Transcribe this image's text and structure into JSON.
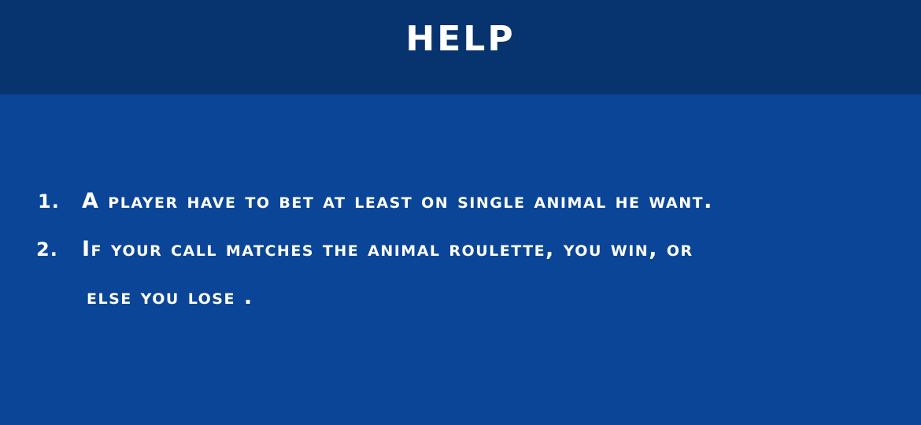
{
  "header": {
    "title": "HELP"
  },
  "rules": [
    {
      "number": "1.",
      "lines": [
        "A player have to bet at least on single animal he want."
      ]
    },
    {
      "number": "2.",
      "lines": [
        "If your call matches the animal roulette, you win, or",
        "else you lose ."
      ]
    }
  ],
  "colors": {
    "header_bg": "#07336f",
    "body_bg": "#0a4597",
    "text": "#ffffff"
  }
}
